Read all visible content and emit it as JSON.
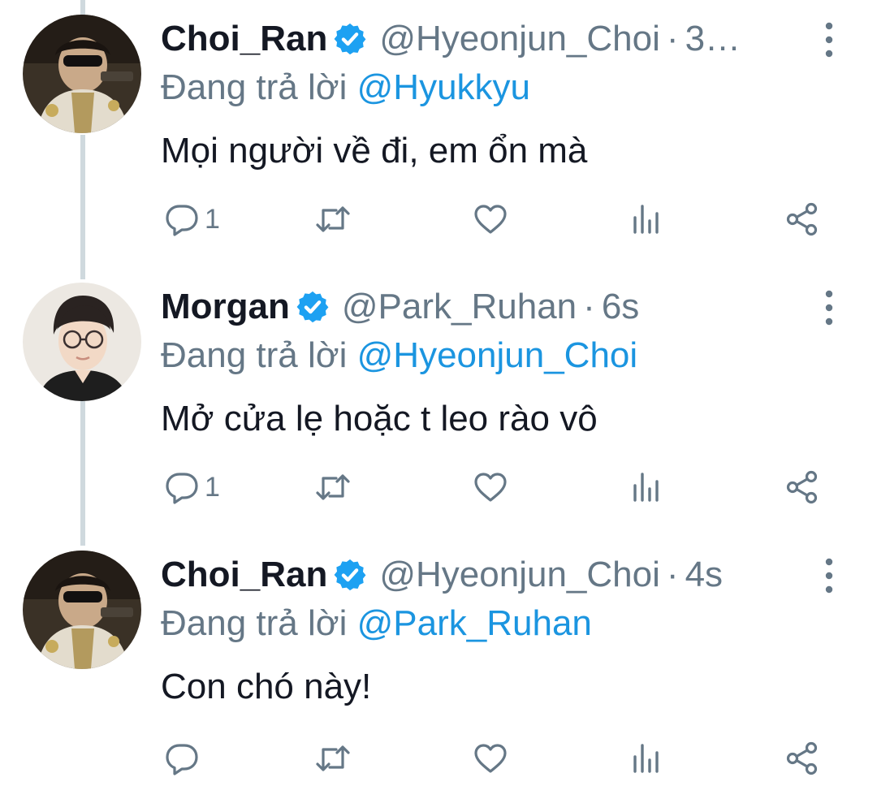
{
  "colors": {
    "name": "#141823",
    "secondary": "#657786",
    "mention": "#1b95e0",
    "verified": "#1da1f2",
    "thread_line": "#cfd9de"
  },
  "icons": {
    "verified": "verified-badge-icon",
    "more": "more-vertical-icon",
    "reply": "reply-icon",
    "retweet": "retweet-icon",
    "like": "like-icon",
    "views": "analytics-icon",
    "share": "share-icon"
  },
  "tweets": [
    {
      "name": "Choi_Ran",
      "handle": "@Hyeonjun_Choi",
      "separator": "·",
      "time": "3…",
      "reply_prefix": "Đang trả lời",
      "reply_to": "@Hyukkyu",
      "text": "Mọi người về đi, em ổn mà",
      "reply_count": "1"
    },
    {
      "name": "Morgan",
      "handle": "@Park_Ruhan",
      "separator": "·",
      "time": "6s",
      "reply_prefix": "Đang trả lời",
      "reply_to": "@Hyeonjun_Choi",
      "text": "Mở cửa lẹ hoặc t leo rào vô",
      "reply_count": "1"
    },
    {
      "name": "Choi_Ran",
      "handle": "@Hyeonjun_Choi",
      "separator": "·",
      "time": "4s",
      "reply_prefix": "Đang trả lời",
      "reply_to": "@Park_Ruhan",
      "text": "Con chó này!",
      "reply_count": ""
    }
  ]
}
